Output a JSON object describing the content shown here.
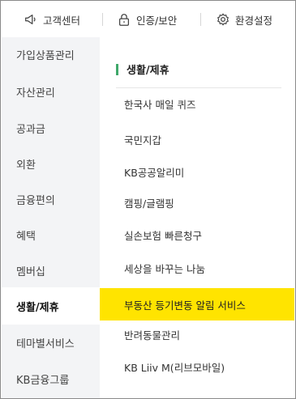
{
  "top_bar": {
    "items": [
      {
        "label": "고객센터",
        "icon": "megaphone-icon"
      },
      {
        "label": "인증/보안",
        "icon": "lock-icon"
      },
      {
        "label": "환경설정",
        "icon": "gear-icon"
      }
    ]
  },
  "left_menu": {
    "items": [
      {
        "label": "가입상품관리"
      },
      {
        "label": "자산관리"
      },
      {
        "label": "공과금"
      },
      {
        "label": "외환"
      },
      {
        "label": "금융편의"
      },
      {
        "label": "혜택"
      },
      {
        "label": "멤버십"
      },
      {
        "label": "생활/제휴",
        "active": true
      },
      {
        "label": "테마별서비스"
      },
      {
        "label": "KB금융그룹"
      }
    ]
  },
  "submenu": {
    "heading": "생활/제휴",
    "items": [
      {
        "label": "한국사 매일 퀴즈"
      },
      {
        "label": "국민지갑"
      },
      {
        "label": "KB공공알리미"
      },
      {
        "label": "캠핑/글램핑"
      },
      {
        "label": "실손보험 빠른청구"
      },
      {
        "label": "세상을 바꾸는 나눔"
      },
      {
        "label": "부동산 등기변동 알림 서비스",
        "highlighted": true
      },
      {
        "label": "반려동물관리"
      },
      {
        "label": "KB Liiv M(리브모바일)"
      }
    ]
  },
  "colors": {
    "highlight": "#ffe400",
    "accent_bar": "#3fa86a",
    "left_menu_bg": "#f3f4f6"
  }
}
